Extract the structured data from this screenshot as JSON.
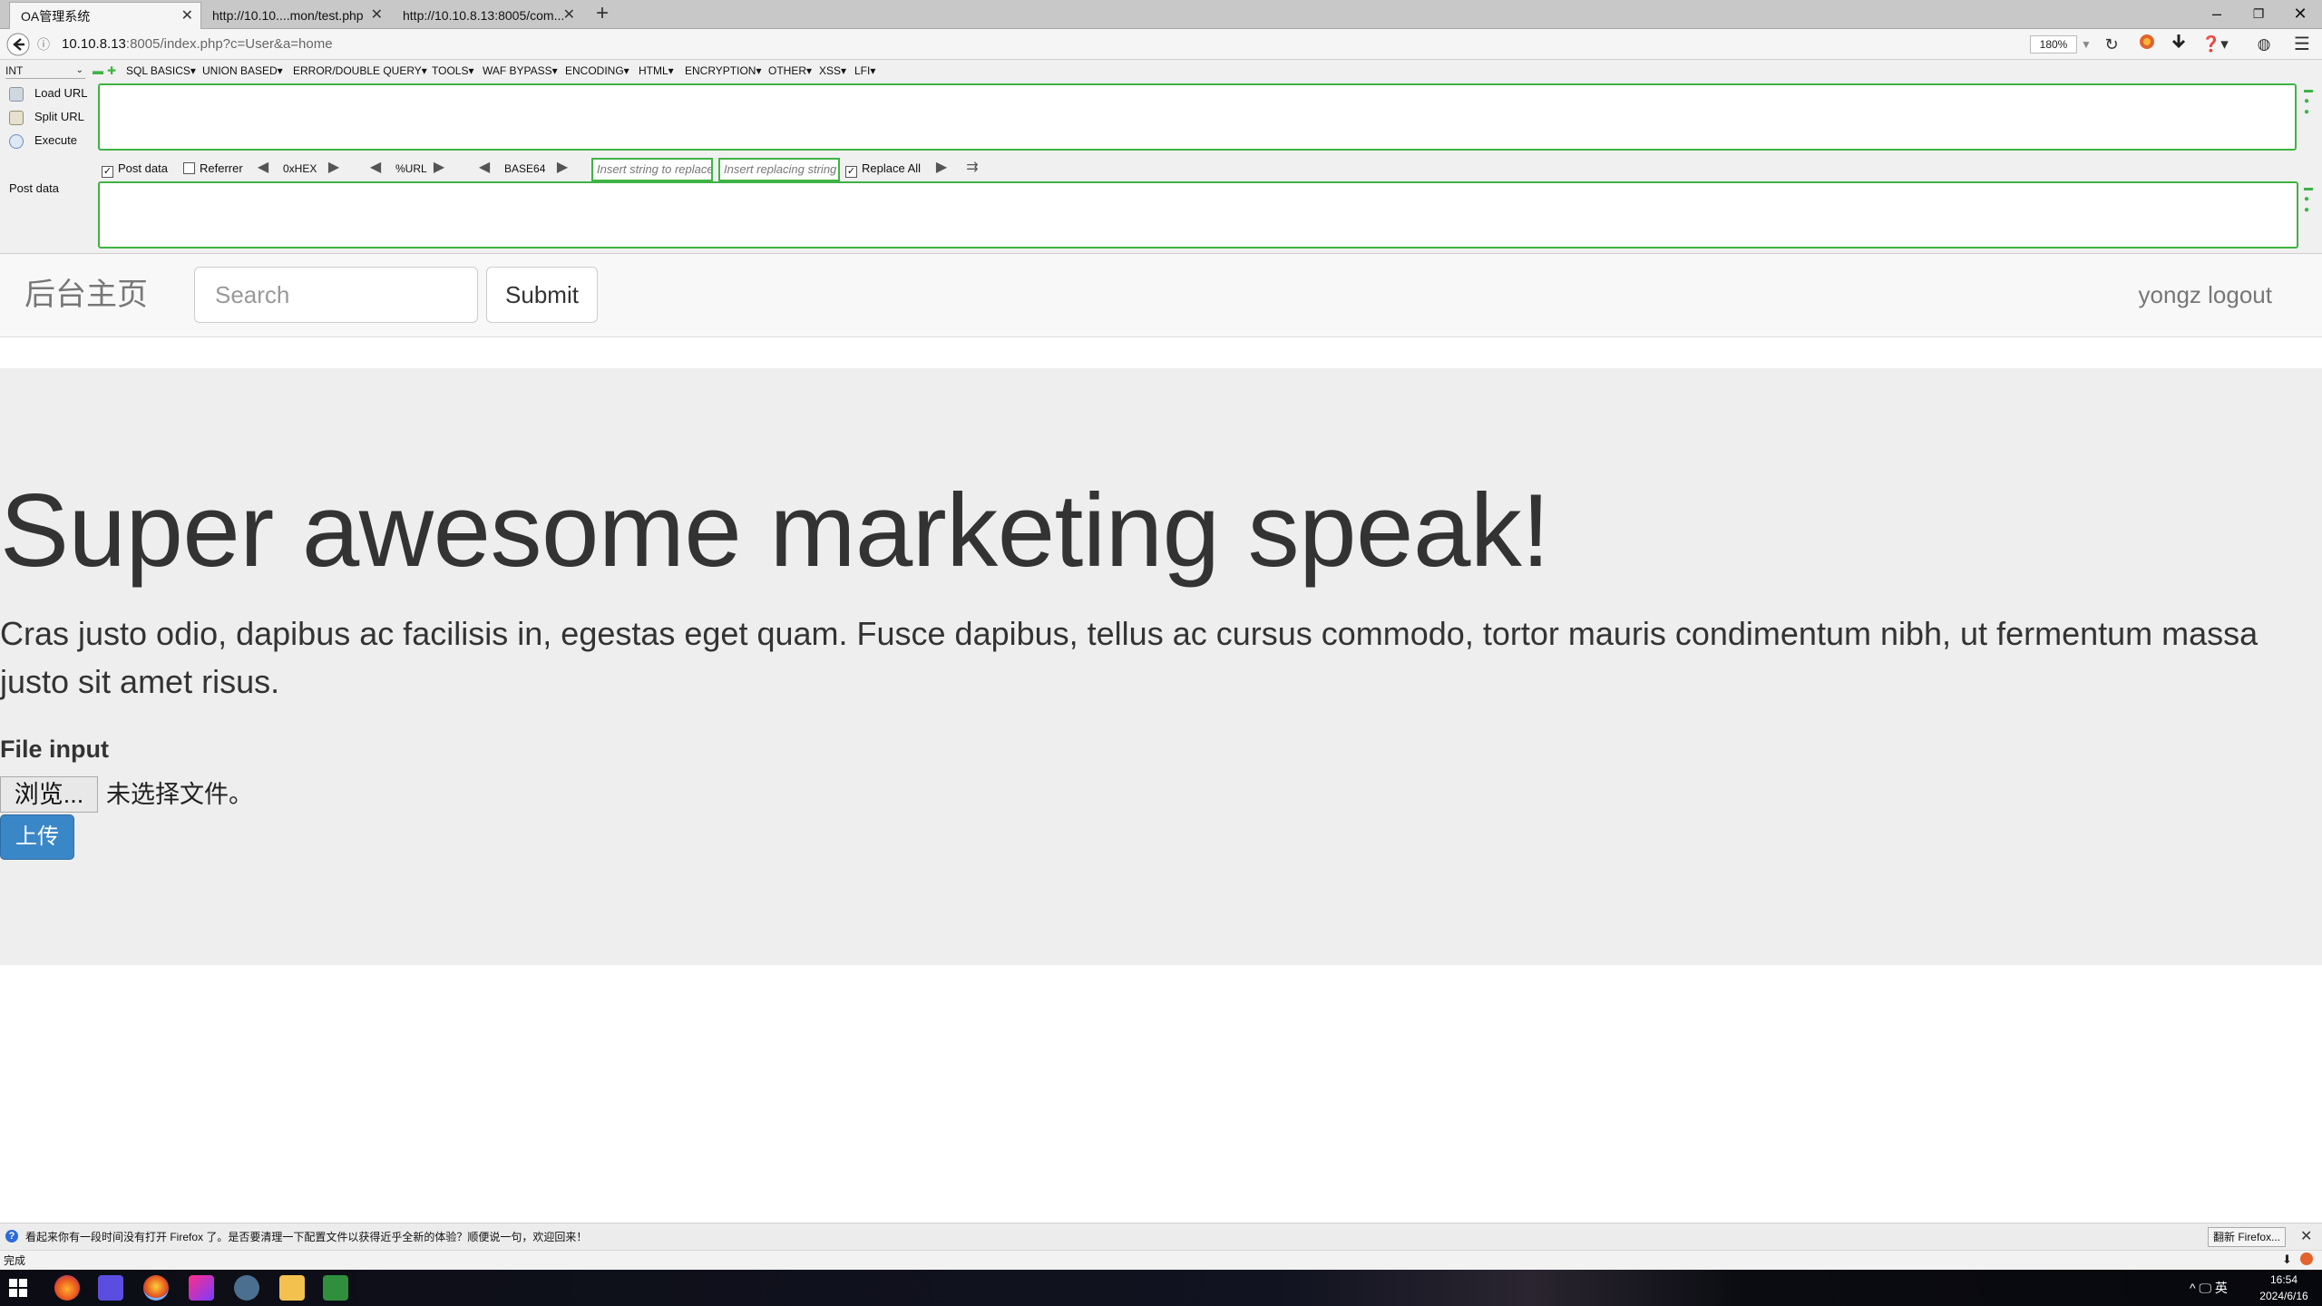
{
  "browser": {
    "tabs": [
      {
        "label": "OA管理系统",
        "active": true
      },
      {
        "label": "http://10.10....mon/test.php",
        "active": false
      },
      {
        "label": "http://10.10.8.13:8005/com...",
        "active": false
      }
    ],
    "new_tab_glyph": "+",
    "url_host": "10.10.8.13",
    "url_rest": ":8005/index.php?c=User&a=home",
    "zoom": "180%",
    "window_controls": {
      "minimize": "–",
      "restore": "❐",
      "close": "✕"
    }
  },
  "hackbar": {
    "select_value": "INT",
    "menu": [
      "SQL BASICS▾",
      "UNION BASED▾",
      "ERROR/DOUBLE QUERY▾",
      "TOOLS▾",
      "WAF BYPASS▾",
      "ENCODING▾",
      "HTML▾",
      "ENCRYPTION▾",
      "OTHER▾",
      "XSS▾",
      "LFI▾"
    ],
    "actions": {
      "load_url": "Load URL",
      "split_url": "Split URL",
      "execute": "Execute"
    },
    "options": {
      "post_data": {
        "label": "Post data",
        "checked": true
      },
      "referrer": {
        "label": "Referrer",
        "checked": false
      },
      "hex": "0xHEX",
      "url": "%URL",
      "base64": "BASE64",
      "replace_find_placeholder": "Insert string to replace",
      "replace_with_placeholder": "Insert replacing string",
      "replace_all": {
        "label": "Replace All",
        "checked": true
      }
    },
    "post_data_label": "Post data"
  },
  "site": {
    "brand": "后台主页",
    "search_placeholder": "Search",
    "submit_label": "Submit",
    "user_link": "yongz logout",
    "headline": "Super awesome marketing speak!",
    "lead": "Cras justo odio, dapibus ac facilisis in, egestas eget quam. Fusce dapibus, tellus ac cursus commodo, tortor mauris condimentum nibh, ut fermentum massa justo sit amet risus.",
    "file_label": "File input",
    "browse_label": "浏览...",
    "no_file_text": "未选择文件。",
    "upload_label": "上传"
  },
  "notification": {
    "text": "看起来你有一段时间没有打开 Firefox 了。是否要清理一下配置文件以获得近乎全新的体验？顺便说一句，欢迎回来！",
    "button": "翻新 Firefox..."
  },
  "status": "完成",
  "taskbar": {
    "tray_text": "^ 🖵 英",
    "time": "16:54",
    "date": "2024/6/16"
  },
  "colors": {
    "hackbar_green": "#3fb344",
    "upload_blue": "#3a87c8",
    "jumbotron_bg": "#eeeeee"
  }
}
